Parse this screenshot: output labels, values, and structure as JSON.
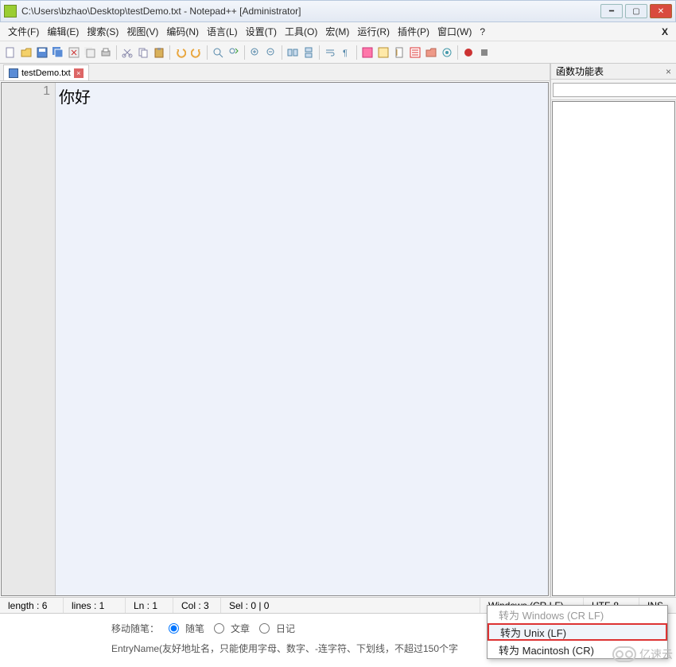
{
  "title": "C:\\Users\\bzhao\\Desktop\\testDemo.txt - Notepad++ [Administrator]",
  "menu": [
    "文件(F)",
    "编辑(E)",
    "搜索(S)",
    "视图(V)",
    "编码(N)",
    "语言(L)",
    "设置(T)",
    "工具(O)",
    "宏(M)",
    "运行(R)",
    "插件(P)",
    "窗口(W)",
    "?"
  ],
  "tab": {
    "name": "testDemo.txt"
  },
  "editor": {
    "line_number": "1",
    "content": "你好"
  },
  "panel": {
    "title": "函数功能表"
  },
  "status": {
    "length": "length : 6",
    "lines": "lines : 1",
    "ln": "Ln : 1",
    "col": "Col : 3",
    "sel": "Sel : 0 | 0",
    "eol": "Windows (CR LF)",
    "enc": "UTF-8",
    "ins": "INS"
  },
  "context_menu": {
    "opt1": "转为 Windows (CR LF)",
    "opt2": "转为 Unix (LF)",
    "opt3": "转为 Macintosh (CR)"
  },
  "bg": {
    "label": "移动随笔：",
    "r1": "随笔",
    "r2": "文章",
    "r3": "日记",
    "entry": "EntryName(友好地址名，只能使用字母、数字、-连字符、下划线，不超过150个字"
  },
  "watermark": "亿速云"
}
